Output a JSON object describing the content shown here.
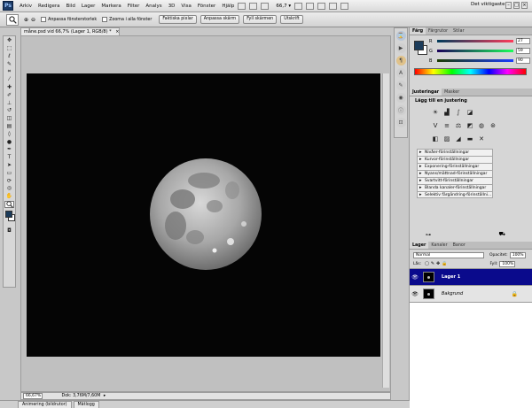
{
  "menubar": {
    "logo": "Ps",
    "items": [
      "Arkiv",
      "Redigera",
      "Bild",
      "Lager",
      "Markera",
      "Filter",
      "Analys",
      "3D",
      "Visa",
      "Fönster",
      "Hjälp"
    ],
    "zoom": "66,7",
    "workspace": "Det viktigaste",
    "window_buttons": [
      "–",
      "□",
      "×"
    ]
  },
  "options": {
    "checkbox1_label": "Anpassa fönsterstorlek",
    "checkbox2_label": "Zooma i alla fönster",
    "btn_actual": "Faktiska pixlar",
    "btn_fit": "Anpassa skärm",
    "btn_fill": "Fyll skärmen",
    "btn_print": "Utskrift"
  },
  "document": {
    "tab_title": "måne.psd vid 66,7% (Lager 1, RGB/8) *",
    "status_zoom": "66,67%",
    "status_doc": "Dok: 3,76M/7,60M"
  },
  "bottom_tabs": [
    "Animering (bildrutor)",
    "Mätlogg"
  ],
  "color_panel": {
    "tabs": [
      "Färg",
      "Färgrutor",
      "Stilar"
    ],
    "rows": [
      {
        "label": "R",
        "value": "27"
      },
      {
        "label": "G",
        "value": "59"
      },
      {
        "label": "B",
        "value": "90"
      }
    ],
    "fg_color": "#1b3b5a"
  },
  "adjust_panel": {
    "tabs": [
      "Justeringar",
      "Masker"
    ],
    "title": "Lägg till en justering",
    "presets": [
      "Nivåer-förinställningar",
      "Kurvor-förinställningar",
      "Exponering-förinställningar",
      "Nyans/mättnad-förinställningar",
      "Svartvitt-förinställningar",
      "Blanda kanaler-förinställningar",
      "Selektiv färgändring-förinställni..."
    ]
  },
  "layers_panel": {
    "tabs": [
      "Lager",
      "Kanaler",
      "Banor"
    ],
    "blend_mode": "Normal",
    "opacity_label": "Opacitet:",
    "opacity_value": "100%",
    "fill_label": "Fyll:",
    "fill_value": "100%",
    "lock_label": "Lås:",
    "layers": [
      {
        "name": "Lager 1",
        "selected": true
      },
      {
        "name": "Bakgrund",
        "selected": false
      }
    ]
  },
  "colors": {
    "selection": "#0a0a8c",
    "panel_bg": "#d6d6d6"
  }
}
